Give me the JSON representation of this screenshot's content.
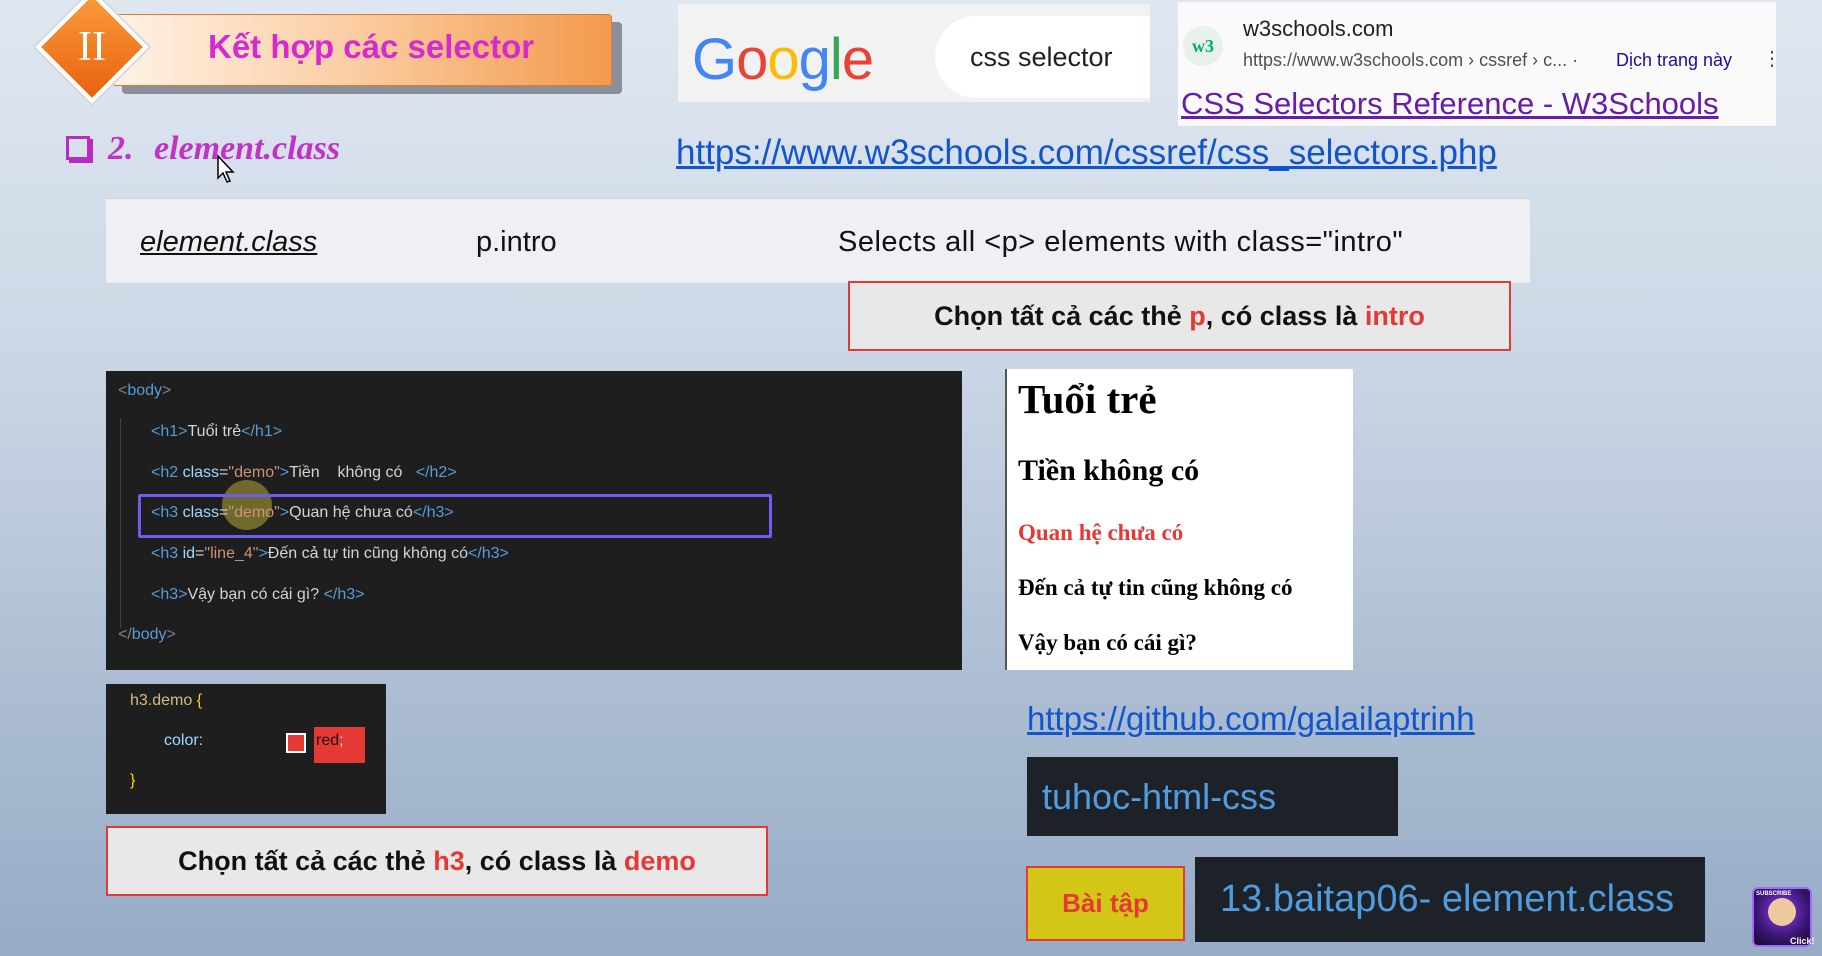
{
  "slide": {
    "title": "Kết hợp các selector",
    "section_number": "II",
    "heading": {
      "number": "2.",
      "label": "element.class"
    },
    "ref_link": "https://www.w3schools.com/cssref/css_selectors.php"
  },
  "google": {
    "logo_letters": [
      "G",
      "o",
      "o",
      "g",
      "l",
      "e"
    ],
    "logo_colors": [
      "#4285f4",
      "#ea4335",
      "#fbbc05",
      "#4285f4",
      "#34a853",
      "#ea4335"
    ],
    "query": "css selector"
  },
  "search_result": {
    "favicon": "w3",
    "site": "w3schools.com",
    "url": "https://www.w3schools.com › cssref › c...  ·",
    "translate": "Dịch trang này",
    "more_icon": "⋮",
    "title": "CSS Selectors Reference - W3Schools"
  },
  "reference_row": {
    "selector": "element.class",
    "example": "p.intro",
    "description": "Selects all <p> elements with class=\"intro\""
  },
  "callout_intro": {
    "prefix": "Chọn tất cả các thẻ ",
    "tag": "p",
    "middle": ", có class là ",
    "class_name": "intro"
  },
  "callout_demo": {
    "prefix": "Chọn tất cả các thẻ ",
    "tag": "h3",
    "middle": ", có class là ",
    "class_name": "demo"
  },
  "html_code": {
    "body_open": {
      "lt": "<",
      "tag": "body",
      "gt": ">"
    },
    "line1": {
      "open": "<h1>",
      "text": "Tuổi trẻ",
      "close": "</h1>"
    },
    "line2": {
      "open_tag": "<h2 ",
      "attr": "class",
      "eq": "=",
      "value": "\"demo\"",
      "gt": ">",
      "text": "Tiền    không có   ",
      "close": "</h2>"
    },
    "line3": {
      "open_tag": "<h3 ",
      "attr": "class",
      "eq": "=",
      "value": "\"demo\"",
      "gt": ">",
      "text": "Quan hệ chưa có",
      "close": "</h3>"
    },
    "line4": {
      "open_tag": "<h3 ",
      "attr": "id",
      "eq": "=",
      "value": "\"line_4\"",
      "gt": ">",
      "text": "Đến cả tự tin cũng không có",
      "close": "</h3>"
    },
    "line5": {
      "open": "<h3>",
      "text": "Vậy bạn có cái gì? ",
      "close": "</h3>"
    },
    "body_close": {
      "lt": "</",
      "tag": "body",
      "gt": ">"
    }
  },
  "css_code": {
    "selector": "h3.demo",
    "brace_open": "{",
    "property": "color:",
    "value": "red",
    "semicolon": ";",
    "brace_close": "}",
    "swatch_color": "#e53935"
  },
  "preview": {
    "h1": "Tuổi trẻ",
    "h2": "Tiền không có",
    "h3_demo": "Quan hệ chưa có",
    "h3_line4": "Đến cả tự tin cũng không có",
    "h3_last": "Vậy bạn có cái gì?",
    "demo_color": "#e53935"
  },
  "github": {
    "link": "https://github.com/galailaptrinh",
    "repo": "tuhoc-html-css"
  },
  "exercise": {
    "button": "Bài tập",
    "name": "13.baitap06- element.class"
  },
  "channel_logo": {
    "top_text": "SUBSCRIBE",
    "bottom_text": "Click!"
  }
}
